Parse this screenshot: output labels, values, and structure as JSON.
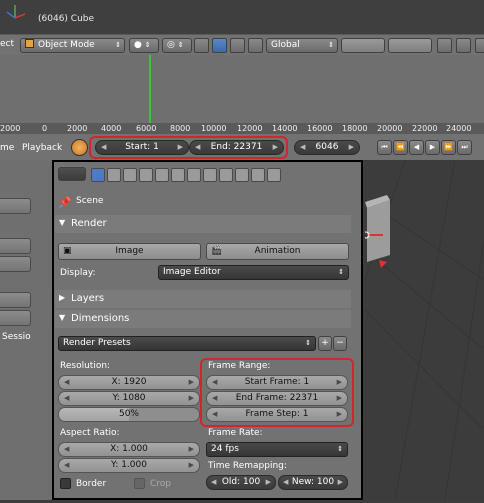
{
  "viewport": {
    "title": "(6046) Cube"
  },
  "header": {
    "mode_prefix": "ect",
    "mode_label": "Object Mode",
    "orientation_label": "Global"
  },
  "timeline": {
    "ruler_ticks": [
      "2000",
      "0",
      "2000",
      "4000",
      "6000",
      "8000",
      "10000",
      "12000",
      "14000",
      "16000",
      "18000",
      "20000",
      "22000",
      "24000"
    ],
    "menu_view_suffix": "me",
    "menu_playback": "Playback",
    "start_label": "Start: 1",
    "end_label": "End: 22371",
    "current_frame": "6046",
    "highlight_color": "#d2262e"
  },
  "properties": {
    "breadcrumb": "Scene",
    "render": {
      "header": "Render",
      "image_button": "Image",
      "animation_button": "Animation",
      "display_label": "Display:",
      "display_value": "Image Editor"
    },
    "layers": {
      "header": "Layers"
    },
    "dimensions": {
      "header": "Dimensions",
      "presets": "Render Presets",
      "resolution_label": "Resolution:",
      "res_x": "X: 1920",
      "res_y": "Y: 1080",
      "res_percent": "50%",
      "res_percent_value": 0.5,
      "frame_range_label": "Frame Range:",
      "start_frame": "Start Frame: 1",
      "end_frame": "End Frame: 22371",
      "frame_step": "Frame Step: 1",
      "aspect_label": "Aspect Ratio:",
      "aspect_x": "X: 1.000",
      "aspect_y": "Y: 1.000",
      "frame_rate_label": "Frame Rate:",
      "fps": "24 fps",
      "time_remap_label": "Time Remapping:",
      "old": "Old: 100",
      "new": "New: 100",
      "border": "Border",
      "crop": "Crop"
    }
  },
  "left_strip": {
    "partial_text": "Sessio"
  }
}
